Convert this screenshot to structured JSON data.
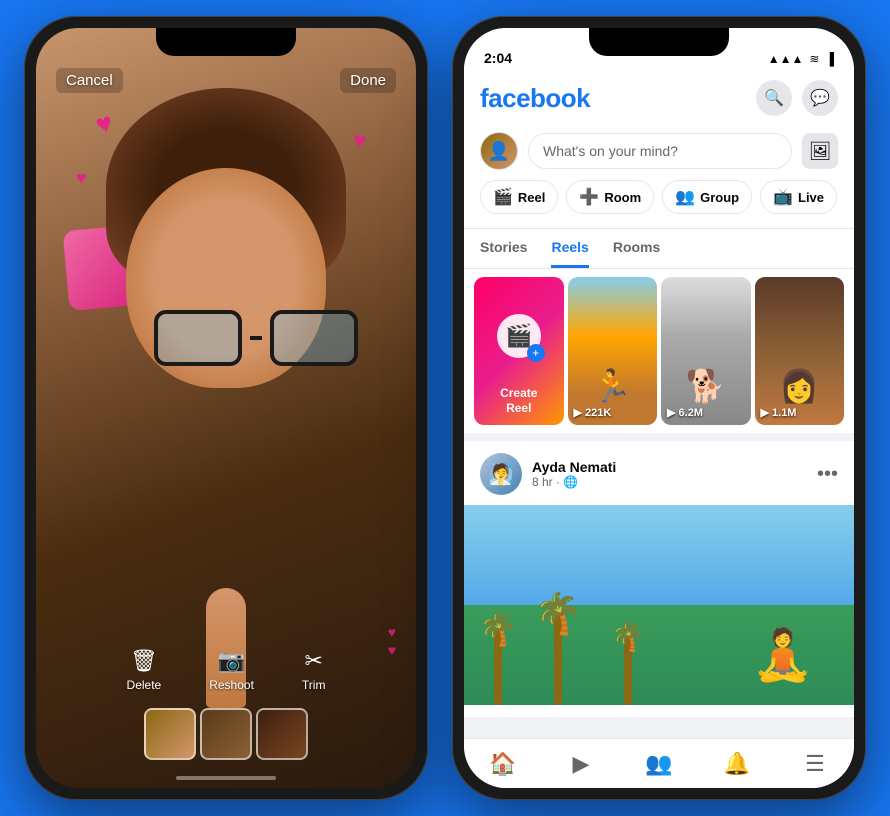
{
  "background_color": "#1877f2",
  "left_phone": {
    "cancel_label": "Cancel",
    "done_label": "Done",
    "actions": [
      {
        "id": "delete",
        "icon": "🗑",
        "label": "Delete"
      },
      {
        "id": "reshoot",
        "icon": "📷",
        "label": "Reshoot"
      },
      {
        "id": "trim",
        "icon": "✂",
        "label": "Trim"
      }
    ]
  },
  "right_phone": {
    "status_bar": {
      "time": "2:04",
      "signal": "▲▲▲",
      "wifi": "WiFi",
      "battery": "🔋"
    },
    "header": {
      "logo": "facebook",
      "search_icon": "🔍",
      "messenger_icon": "💬"
    },
    "post_bar": {
      "placeholder": "What's on your mind?"
    },
    "quick_actions": [
      {
        "id": "reel",
        "icon": "🎬",
        "label": "Reel",
        "color": "#e44d26"
      },
      {
        "id": "room",
        "icon": "➕",
        "label": "Room",
        "color": "#1877f2"
      },
      {
        "id": "group",
        "icon": "👥",
        "label": "Group",
        "color": "#2e7d32"
      },
      {
        "id": "live",
        "icon": "📺",
        "label": "Live",
        "color": "#e44d26"
      }
    ],
    "tabs": [
      {
        "id": "stories",
        "label": "Stories",
        "active": false
      },
      {
        "id": "reels",
        "label": "Reels",
        "active": true
      },
      {
        "id": "rooms",
        "label": "Rooms",
        "active": false
      }
    ],
    "reels": [
      {
        "id": "create",
        "label": "Create\nReel",
        "type": "create"
      },
      {
        "id": "reel1",
        "views": "▶ 221K"
      },
      {
        "id": "reel2",
        "views": "▶ 6.2M"
      },
      {
        "id": "reel3",
        "views": "▶ 1.1M"
      }
    ],
    "post": {
      "user_name": "Ayda Nemati",
      "user_meta": "8 hr · 🌐",
      "more_icon": "•••"
    },
    "bottom_nav": [
      {
        "id": "home",
        "icon": "🏠",
        "active": true
      },
      {
        "id": "video",
        "icon": "▶",
        "active": false
      },
      {
        "id": "people",
        "icon": "👥",
        "active": false
      },
      {
        "id": "bell",
        "icon": "🔔",
        "active": false
      },
      {
        "id": "menu",
        "icon": "☰",
        "active": false
      }
    ]
  }
}
